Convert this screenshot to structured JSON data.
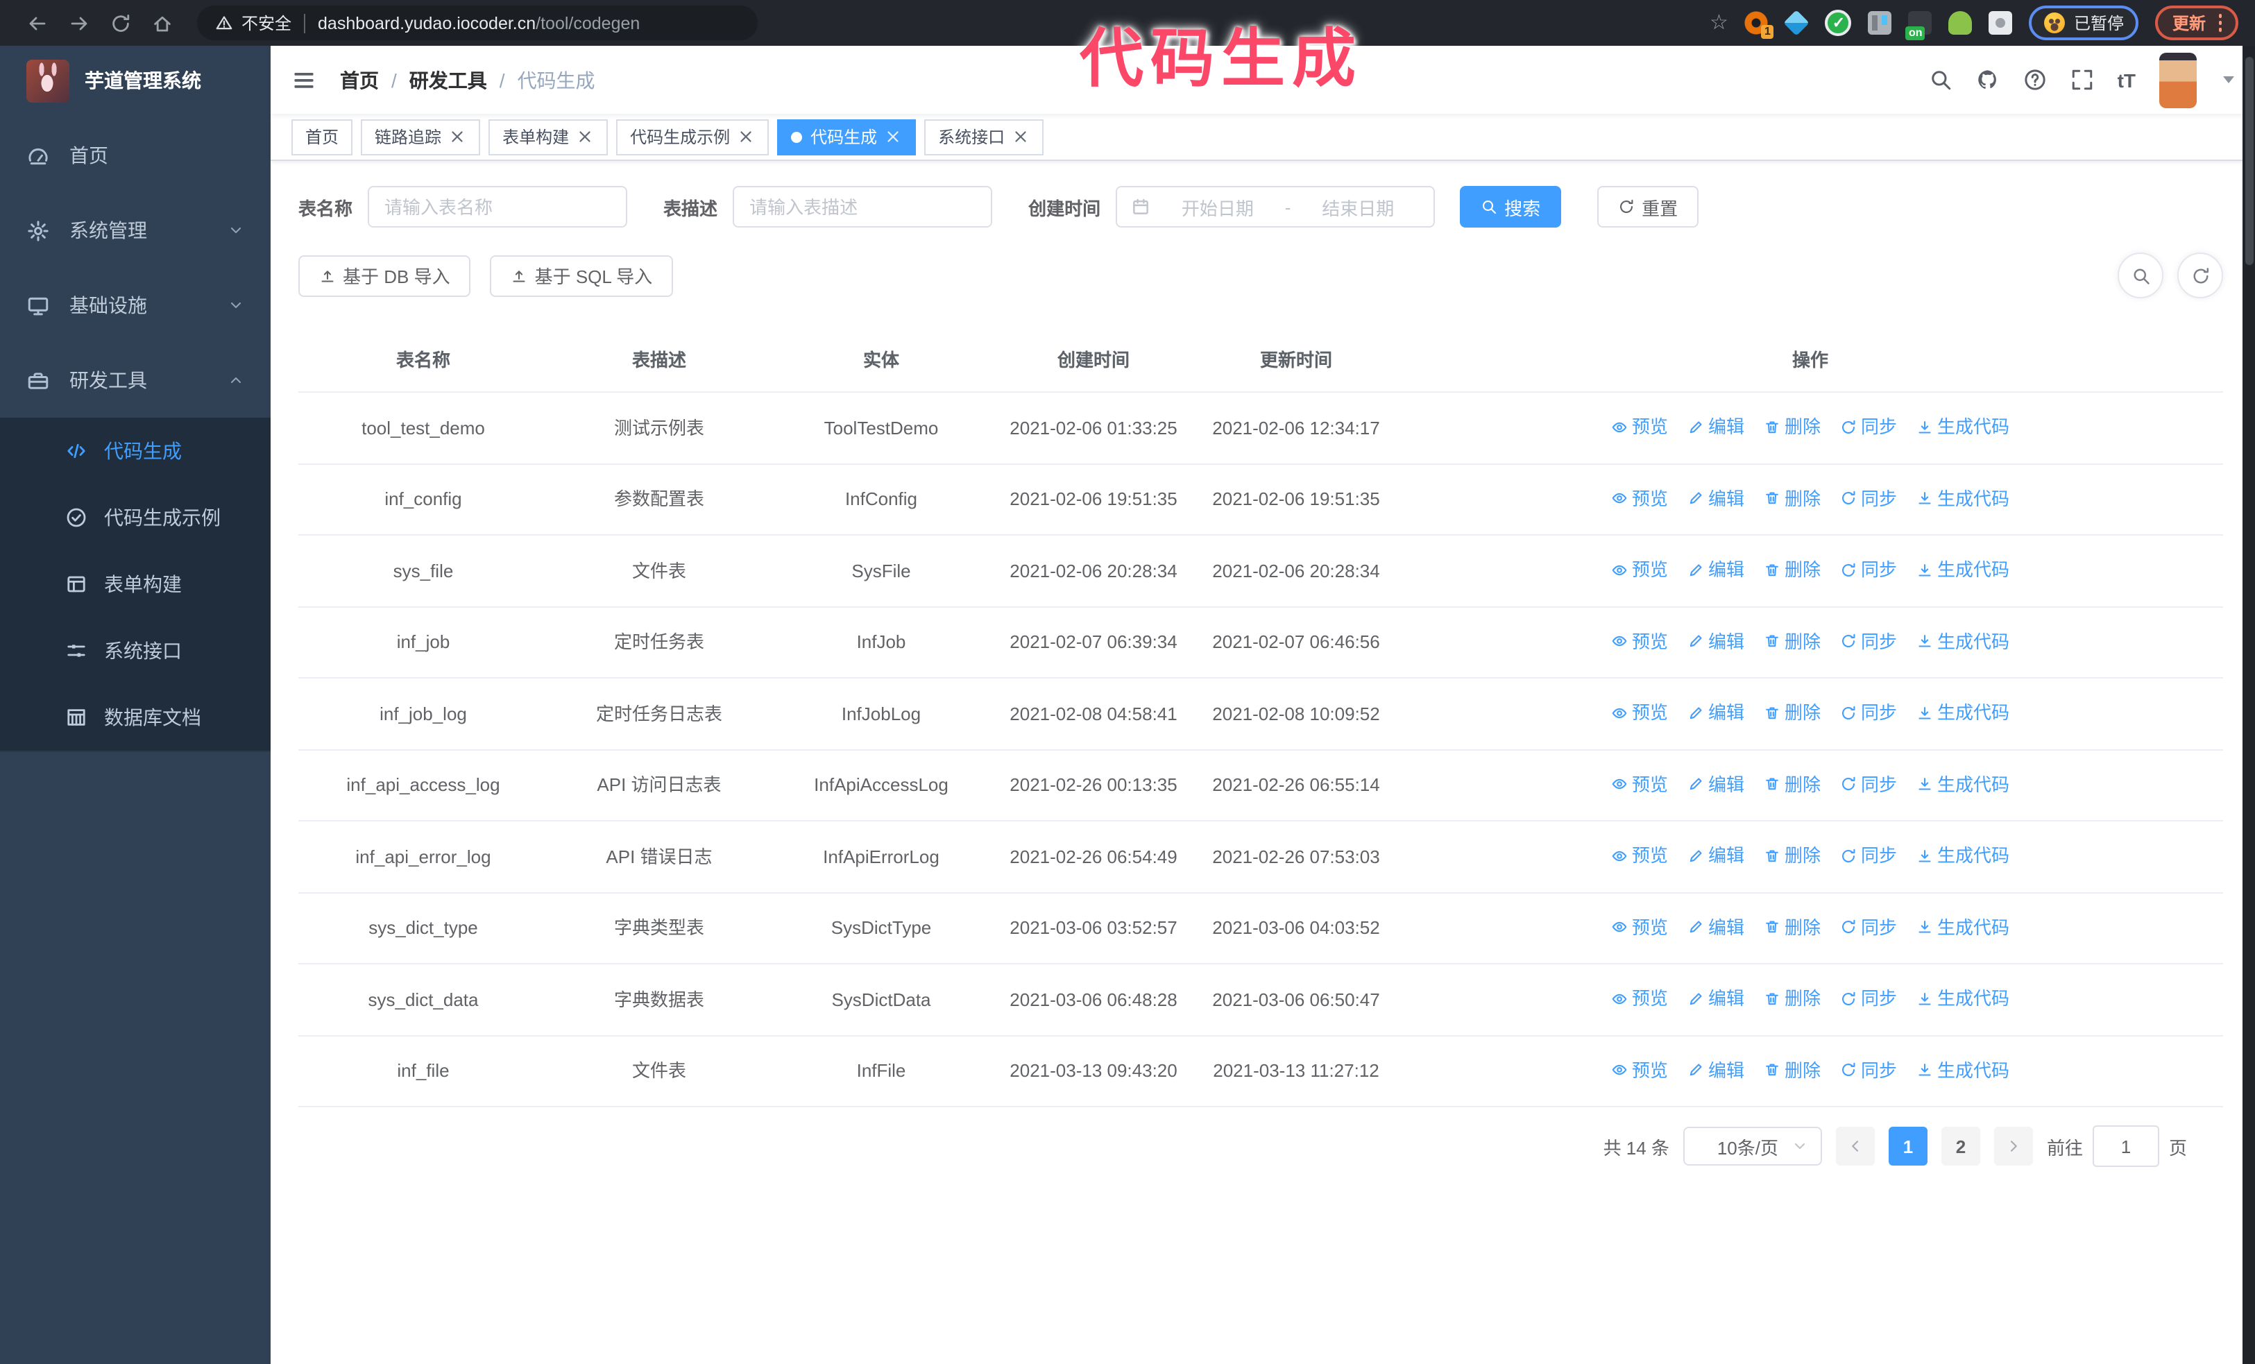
{
  "theme": {
    "accent": "#409EFF",
    "sidebar_bg": "#304156",
    "submenu_bg": "#1f2d3d",
    "annotation_color": "#fb4768",
    "active_tab_bg": "#409EFF"
  },
  "browser": {
    "security_label": "不安全",
    "url_host": "dashboard.yudao.iocoder.cn",
    "url_path": "/tool/codegen",
    "ext_badge": "1",
    "on_badge": "on",
    "paused_badge": "已暂停",
    "update_button": "更新"
  },
  "annotation": {
    "text": "代码生成"
  },
  "sidebar": {
    "title": "芋道管理系统",
    "items": [
      {
        "key": "home",
        "label": "首页",
        "icon": "dashboard",
        "chevron": ""
      },
      {
        "key": "system",
        "label": "系统管理",
        "icon": "gear",
        "chevron": "down"
      },
      {
        "key": "infra",
        "label": "基础设施",
        "icon": "monitor",
        "chevron": "down"
      },
      {
        "key": "devtools",
        "label": "研发工具",
        "icon": "toolbox",
        "chevron": "up"
      }
    ],
    "subitems": [
      {
        "key": "codegen",
        "label": "代码生成",
        "icon": "code",
        "active": true
      },
      {
        "key": "codegen-example",
        "label": "代码生成示例",
        "icon": "checkcircle",
        "active": false
      },
      {
        "key": "form-build",
        "label": "表单构建",
        "icon": "form",
        "active": false
      },
      {
        "key": "system-api",
        "label": "系统接口",
        "icon": "sliders",
        "active": false
      },
      {
        "key": "db-doc",
        "label": "数据库文档",
        "icon": "grid",
        "active": false
      }
    ]
  },
  "navbar": {
    "breadcrumb": [
      "首页",
      "研发工具",
      "代码生成"
    ],
    "breadcrumb_separator": "/",
    "font_size_icon_label": "tT"
  },
  "tabs": [
    {
      "key": "home",
      "label": "首页",
      "closable": false,
      "active": false
    },
    {
      "key": "tracing",
      "label": "链路追踪",
      "closable": true,
      "active": false
    },
    {
      "key": "form-build",
      "label": "表单构建",
      "closable": true,
      "active": false
    },
    {
      "key": "codegen-example",
      "label": "代码生成示例",
      "closable": true,
      "active": false
    },
    {
      "key": "codegen",
      "label": "代码生成",
      "closable": true,
      "active": true
    },
    {
      "key": "system-api",
      "label": "系统接口",
      "closable": true,
      "active": false
    }
  ],
  "filters": {
    "name_label": "表名称",
    "name_placeholder": "请输入表名称",
    "desc_label": "表描述",
    "desc_placeholder": "请输入表描述",
    "time_label": "创建时间",
    "date_start_placeholder": "开始日期",
    "date_separator": "-",
    "date_end_placeholder": "结束日期",
    "search_label": "搜索",
    "reset_label": "重置"
  },
  "toolbar": {
    "import_db_label": "基于 DB 导入",
    "import_sql_label": "基于 SQL 导入"
  },
  "table": {
    "columns": [
      "表名称",
      "表描述",
      "实体",
      "创建时间",
      "更新时间",
      "操作"
    ],
    "actions": [
      "预览",
      "编辑",
      "删除",
      "同步",
      "生成代码"
    ],
    "rows": [
      {
        "name": "tool_test_demo",
        "desc": "测试示例表",
        "entity": "ToolTestDemo",
        "create_time": "2021-02-06 01:33:25",
        "update_time": "2021-02-06 12:34:17"
      },
      {
        "name": "inf_config",
        "desc": "参数配置表",
        "entity": "InfConfig",
        "create_time": "2021-02-06 19:51:35",
        "update_time": "2021-02-06 19:51:35"
      },
      {
        "name": "sys_file",
        "desc": "文件表",
        "entity": "SysFile",
        "create_time": "2021-02-06 20:28:34",
        "update_time": "2021-02-06 20:28:34"
      },
      {
        "name": "inf_job",
        "desc": "定时任务表",
        "entity": "InfJob",
        "create_time": "2021-02-07 06:39:34",
        "update_time": "2021-02-07 06:46:56"
      },
      {
        "name": "inf_job_log",
        "desc": "定时任务日志表",
        "entity": "InfJobLog",
        "create_time": "2021-02-08 04:58:41",
        "update_time": "2021-02-08 10:09:52"
      },
      {
        "name": "inf_api_access_log",
        "desc": "API 访问日志表",
        "entity": "InfApiAccessLog",
        "create_time": "2021-02-26 00:13:35",
        "update_time": "2021-02-26 06:55:14"
      },
      {
        "name": "inf_api_error_log",
        "desc": "API 错误日志",
        "entity": "InfApiErrorLog",
        "create_time": "2021-02-26 06:54:49",
        "update_time": "2021-02-26 07:53:03"
      },
      {
        "name": "sys_dict_type",
        "desc": "字典类型表",
        "entity": "SysDictType",
        "create_time": "2021-03-06 03:52:57",
        "update_time": "2021-03-06 04:03:52"
      },
      {
        "name": "sys_dict_data",
        "desc": "字典数据表",
        "entity": "SysDictData",
        "create_time": "2021-03-06 06:48:28",
        "update_time": "2021-03-06 06:50:47"
      },
      {
        "name": "inf_file",
        "desc": "文件表",
        "entity": "InfFile",
        "create_time": "2021-03-13 09:43:20",
        "update_time": "2021-03-13 11:27:12"
      }
    ]
  },
  "pagination": {
    "total": "共 14 条",
    "page_size": "10条/页",
    "pages": [
      "1",
      "2"
    ],
    "active_page": "1",
    "goto_label": "前往",
    "goto_value": "1",
    "unit": "页"
  }
}
